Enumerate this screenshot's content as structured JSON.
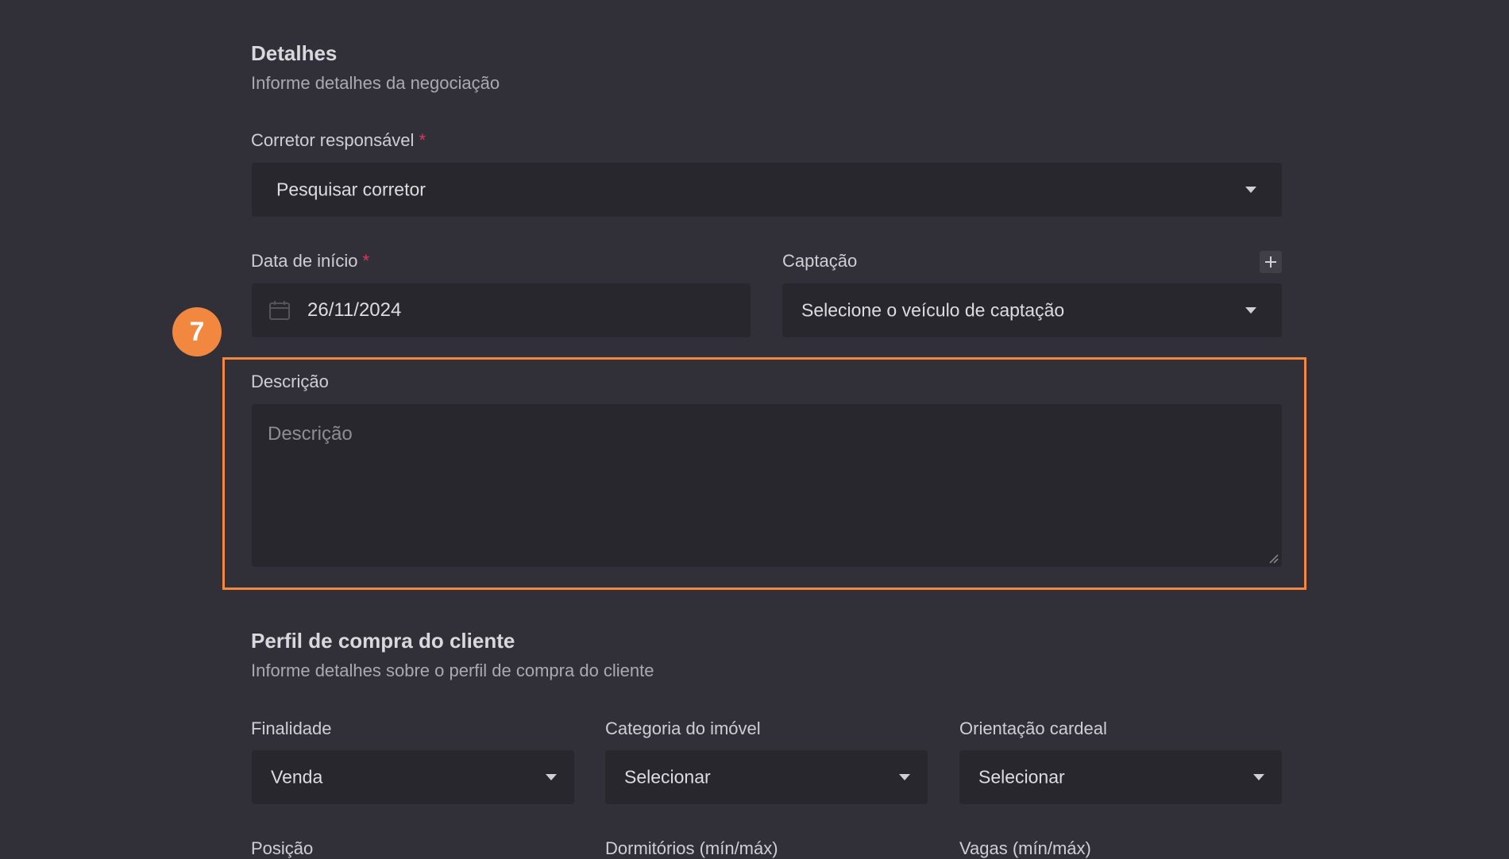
{
  "step_badge": "7",
  "details": {
    "title": "Detalhes",
    "subtitle": "Informe detalhes da negociação",
    "broker": {
      "label": "Corretor responsável",
      "required_mark": "*",
      "value": "Pesquisar corretor"
    },
    "start_date": {
      "label": "Data de início",
      "required_mark": "*",
      "value": "26/11/2024"
    },
    "capture": {
      "label": "Captação",
      "value": "Selecione o veículo de captação"
    },
    "description": {
      "label": "Descrição",
      "placeholder": "Descrição"
    }
  },
  "profile": {
    "title": "Perfil de compra do cliente",
    "subtitle": "Informe detalhes sobre o perfil de compra do cliente",
    "purpose": {
      "label": "Finalidade",
      "value": "Venda"
    },
    "category": {
      "label": "Categoria do imóvel",
      "value": "Selecionar"
    },
    "orientation": {
      "label": "Orientação cardeal",
      "value": "Selecionar"
    },
    "position": {
      "label": "Posição"
    },
    "bedrooms": {
      "label": "Dormitórios (mín/máx)"
    },
    "parking": {
      "label": "Vagas (mín/máx)"
    }
  },
  "colors": {
    "background": "#313038",
    "field": "#28272d",
    "highlight": "#f2883f",
    "required": "#e0355b"
  }
}
